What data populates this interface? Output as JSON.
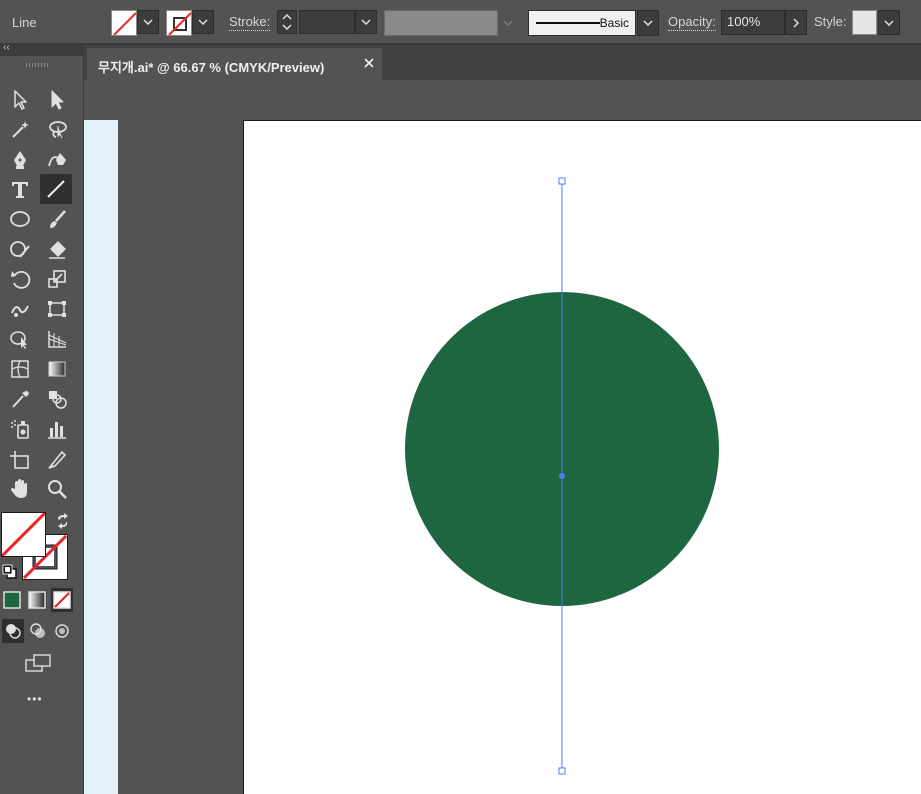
{
  "control_bar": {
    "tool_name": "Line",
    "stroke_label": "Stroke:",
    "stroke_weight": "",
    "profile_label": "Basic",
    "opacity_label": "Opacity:",
    "opacity_value": "100%",
    "style_label": "Style:"
  },
  "document_tab": {
    "title": "무지개.ai* @ 66.67 % (CMYK/Preview)",
    "close_glyph": "×"
  },
  "tools_panel": {
    "collapse_glyph": "‹‹",
    "more_glyph": "•••",
    "active_tool": "line-segment-tool"
  },
  "artwork": {
    "circle_fill": "#1e6640",
    "selection_color": "#4a7fff"
  },
  "colors": {
    "ui_background": "#535353",
    "dark_panel": "#424242",
    "none_slash": "#e8262a",
    "pasteboard": "#e3f1f8"
  }
}
